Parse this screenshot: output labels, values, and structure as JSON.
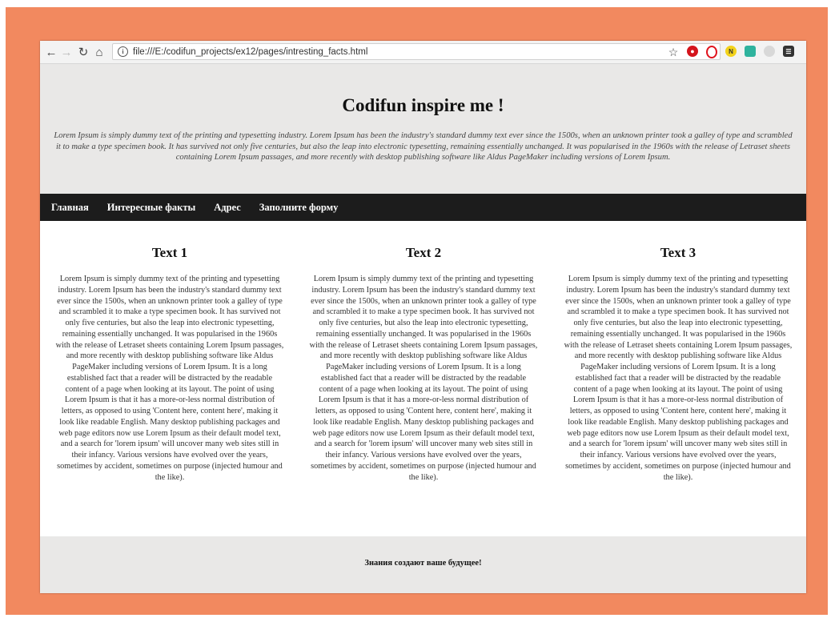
{
  "browser": {
    "url": "file:///E:/codifun_projects/ex12/pages/intresting_facts.html",
    "icons": [
      "back-icon",
      "forward-icon",
      "reload-icon",
      "home-icon",
      "info-icon",
      "star-icon",
      "adblock-icon",
      "opera-icon",
      "norton-icon",
      "extension-icon",
      "disabled-extension-icon",
      "menu-icon"
    ]
  },
  "header": {
    "title": "Codifun inspire me !",
    "intro": "Lorem Ipsum is simply dummy text of the printing and typesetting industry. Lorem Ipsum has been the industry's standard dummy text ever since the 1500s, when an unknown printer took a galley of type and scrambled it to make a type specimen book. It has survived not only five centuries, but also the leap into electronic typesetting, remaining essentially unchanged. It was popularised in the 1960s with the release of Letraset sheets containing Lorem Ipsum passages, and more recently with desktop publishing software like Aldus PageMaker including versions of Lorem Ipsum."
  },
  "menu": {
    "items": [
      {
        "label": "Главная"
      },
      {
        "label": "Интересные факты"
      },
      {
        "label": "Адрес"
      },
      {
        "label": "Заполните форму"
      }
    ]
  },
  "columns": [
    {
      "title": "Text 1",
      "body": "Lorem Ipsum is simply dummy text of the printing and typesetting industry. Lorem Ipsum has been the industry's standard dummy text ever since the 1500s, when an unknown printer took a galley of type and scrambled it to make a type specimen book. It has survived not only five centuries, but also the leap into electronic typesetting, remaining essentially unchanged. It was popularised in the 1960s with the release of Letraset sheets containing Lorem Ipsum passages, and more recently with desktop publishing software like Aldus PageMaker including versions of Lorem Ipsum. It is a long established fact that a reader will be distracted by the readable content of a page when looking at its layout. The point of using Lorem Ipsum is that it has a more-or-less normal distribution of letters, as opposed to using 'Content here, content here', making it look like readable English. Many desktop publishing packages and web page editors now use Lorem Ipsum as their default model text, and a search for 'lorem ipsum' will uncover many web sites still in their infancy. Various versions have evolved over the years, sometimes by accident, sometimes on purpose (injected humour and the like)."
    },
    {
      "title": "Text 2",
      "body": "Lorem Ipsum is simply dummy text of the printing and typesetting industry. Lorem Ipsum has been the industry's standard dummy text ever since the 1500s, when an unknown printer took a galley of type and scrambled it to make a type specimen book. It has survived not only five centuries, but also the leap into electronic typesetting, remaining essentially unchanged. It was popularised in the 1960s with the release of Letraset sheets containing Lorem Ipsum passages, and more recently with desktop publishing software like Aldus PageMaker including versions of Lorem Ipsum. It is a long established fact that a reader will be distracted by the readable content of a page when looking at its layout. The point of using Lorem Ipsum is that it has a more-or-less normal distribution of letters, as opposed to using 'Content here, content here', making it look like readable English. Many desktop publishing packages and web page editors now use Lorem Ipsum as their default model text, and a search for 'lorem ipsum' will uncover many web sites still in their infancy. Various versions have evolved over the years, sometimes by accident, sometimes on purpose (injected humour and the like)."
    },
    {
      "title": "Text 3",
      "body": "Lorem Ipsum is simply dummy text of the printing and typesetting industry. Lorem Ipsum has been the industry's standard dummy text ever since the 1500s, when an unknown printer took a galley of type and scrambled it to make a type specimen book. It has survived not only five centuries, but also the leap into electronic typesetting, remaining essentially unchanged. It was popularised in the 1960s with the release of Letraset sheets containing Lorem Ipsum passages, and more recently with desktop publishing software like Aldus PageMaker including versions of Lorem Ipsum. It is a long established fact that a reader will be distracted by the readable content of a page when looking at its layout. The point of using Lorem Ipsum is that it has a more-or-less normal distribution of letters, as opposed to using 'Content here, content here', making it look like readable English. Many desktop publishing packages and web page editors now use Lorem Ipsum as their default model text, and a search for 'lorem ipsum' will uncover many web sites still in their infancy. Various versions have evolved over the years, sometimes by accident, sometimes on purpose (injected humour and the like)."
    }
  ],
  "footer": {
    "text": "Знания создают ваше будущее!"
  },
  "colors": {
    "frame": "#f2895f",
    "header_bg": "#e9e8e7",
    "menu_bg": "#1c1c1c"
  }
}
